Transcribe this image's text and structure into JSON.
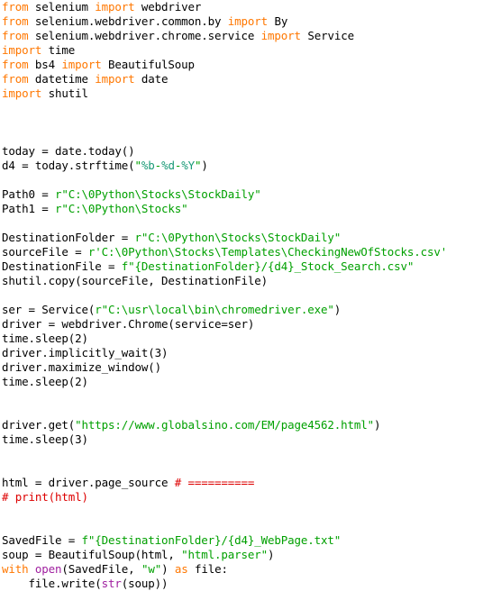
{
  "editor": {
    "name": "python-code-view",
    "language": "Python",
    "background_color": "#ffffff",
    "colors": {
      "keyword": "#ff7700",
      "string": "#00a000",
      "format_spec": "#1a9a77",
      "comment": "#dd0000",
      "builtin": "#a020a0",
      "plain": "#000000"
    }
  },
  "lines": [
    {
      "n": 1,
      "tokens": [
        {
          "t": "from",
          "c": "kw"
        },
        {
          "t": " selenium ",
          "c": "plain"
        },
        {
          "t": "import",
          "c": "kw"
        },
        {
          "t": " webdriver",
          "c": "plain"
        }
      ]
    },
    {
      "n": 2,
      "tokens": [
        {
          "t": "from",
          "c": "kw"
        },
        {
          "t": " selenium.webdriver.common.by ",
          "c": "plain"
        },
        {
          "t": "import",
          "c": "kw"
        },
        {
          "t": " By",
          "c": "plain"
        }
      ]
    },
    {
      "n": 3,
      "tokens": [
        {
          "t": "from",
          "c": "kw"
        },
        {
          "t": " selenium.webdriver.chrome.service ",
          "c": "plain"
        },
        {
          "t": "import",
          "c": "kw"
        },
        {
          "t": " Service",
          "c": "plain"
        }
      ]
    },
    {
      "n": 4,
      "tokens": [
        {
          "t": "import",
          "c": "kw"
        },
        {
          "t": " time",
          "c": "plain"
        }
      ]
    },
    {
      "n": 5,
      "tokens": [
        {
          "t": "from",
          "c": "kw"
        },
        {
          "t": " bs4 ",
          "c": "plain"
        },
        {
          "t": "import",
          "c": "kw"
        },
        {
          "t": " BeautifulSoup",
          "c": "plain"
        }
      ]
    },
    {
      "n": 6,
      "tokens": [
        {
          "t": "from",
          "c": "kw"
        },
        {
          "t": " datetime ",
          "c": "plain"
        },
        {
          "t": "import",
          "c": "kw"
        },
        {
          "t": " date",
          "c": "plain"
        }
      ]
    },
    {
      "n": 7,
      "tokens": [
        {
          "t": "import",
          "c": "kw"
        },
        {
          "t": " shutil",
          "c": "plain"
        }
      ]
    },
    {
      "n": 8,
      "tokens": []
    },
    {
      "n": 9,
      "tokens": []
    },
    {
      "n": 10,
      "tokens": []
    },
    {
      "n": 11,
      "tokens": [
        {
          "t": "today = date.today()",
          "c": "plain"
        }
      ]
    },
    {
      "n": 12,
      "tokens": [
        {
          "t": "d4 = today.strftime(",
          "c": "plain"
        },
        {
          "t": "\"",
          "c": "str"
        },
        {
          "t": "%b",
          "c": "fmt"
        },
        {
          "t": "-",
          "c": "str"
        },
        {
          "t": "%d",
          "c": "fmt"
        },
        {
          "t": "-",
          "c": "str"
        },
        {
          "t": "%Y",
          "c": "fmt"
        },
        {
          "t": "\"",
          "c": "str"
        },
        {
          "t": ")",
          "c": "plain"
        }
      ]
    },
    {
      "n": 13,
      "tokens": []
    },
    {
      "n": 14,
      "tokens": [
        {
          "t": "Path0 = ",
          "c": "plain"
        },
        {
          "t": "r\"C:\\0Python\\Stocks\\StockDaily\"",
          "c": "str"
        }
      ]
    },
    {
      "n": 15,
      "tokens": [
        {
          "t": "Path1 = ",
          "c": "plain"
        },
        {
          "t": "r\"C:\\0Python\\Stocks\"",
          "c": "str"
        }
      ]
    },
    {
      "n": 16,
      "tokens": []
    },
    {
      "n": 17,
      "tokens": [
        {
          "t": "DestinationFolder = ",
          "c": "plain"
        },
        {
          "t": "r\"C:\\0Python\\Stocks\\StockDaily\"",
          "c": "str"
        }
      ]
    },
    {
      "n": 18,
      "tokens": [
        {
          "t": "sourceFile = ",
          "c": "plain"
        },
        {
          "t": "r'C:\\0Python\\Stocks\\Templates\\CheckingNewOfStocks.csv'",
          "c": "str"
        }
      ]
    },
    {
      "n": 19,
      "tokens": [
        {
          "t": "DestinationFile = ",
          "c": "plain"
        },
        {
          "t": "f\"{DestinationFolder}/{d4}_Stock_Search.csv\"",
          "c": "str"
        }
      ]
    },
    {
      "n": 20,
      "tokens": [
        {
          "t": "shutil.copy(sourceFile, DestinationFile)",
          "c": "plain"
        }
      ]
    },
    {
      "n": 21,
      "tokens": []
    },
    {
      "n": 22,
      "tokens": [
        {
          "t": "ser = Service(",
          "c": "plain"
        },
        {
          "t": "r\"C:\\usr\\local\\bin\\chromedriver.exe\"",
          "c": "str"
        },
        {
          "t": ")",
          "c": "plain"
        }
      ]
    },
    {
      "n": 23,
      "tokens": [
        {
          "t": "driver = webdriver.Chrome(service=ser)",
          "c": "plain"
        }
      ]
    },
    {
      "n": 24,
      "tokens": [
        {
          "t": "time.sleep(2)",
          "c": "plain"
        }
      ]
    },
    {
      "n": 25,
      "tokens": [
        {
          "t": "driver.implicitly_wait(3)",
          "c": "plain"
        }
      ]
    },
    {
      "n": 26,
      "tokens": [
        {
          "t": "driver.maximize_window()",
          "c": "plain"
        }
      ]
    },
    {
      "n": 27,
      "tokens": [
        {
          "t": "time.sleep(2)",
          "c": "plain"
        }
      ]
    },
    {
      "n": 28,
      "tokens": []
    },
    {
      "n": 29,
      "tokens": []
    },
    {
      "n": 30,
      "tokens": [
        {
          "t": "driver.get(",
          "c": "plain"
        },
        {
          "t": "\"https://www.globalsino.com/EM/page4562.html\"",
          "c": "str"
        },
        {
          "t": ")",
          "c": "plain"
        }
      ]
    },
    {
      "n": 31,
      "tokens": [
        {
          "t": "time.sleep(3)",
          "c": "plain"
        }
      ]
    },
    {
      "n": 32,
      "tokens": []
    },
    {
      "n": 33,
      "tokens": []
    },
    {
      "n": 34,
      "tokens": [
        {
          "t": "html = driver.page_source ",
          "c": "plain"
        },
        {
          "t": "# ==========",
          "c": "com"
        }
      ]
    },
    {
      "n": 35,
      "tokens": [
        {
          "t": "# print(html)",
          "c": "com"
        }
      ]
    },
    {
      "n": 36,
      "tokens": []
    },
    {
      "n": 37,
      "tokens": []
    },
    {
      "n": 38,
      "tokens": [
        {
          "t": "SavedFile = ",
          "c": "plain"
        },
        {
          "t": "f\"{DestinationFolder}/{d4}_WebPage.txt\"",
          "c": "str"
        }
      ]
    },
    {
      "n": 39,
      "tokens": [
        {
          "t": "soup = BeautifulSoup(html, ",
          "c": "plain"
        },
        {
          "t": "\"html.parser\"",
          "c": "str"
        },
        {
          "t": ")",
          "c": "plain"
        }
      ]
    },
    {
      "n": 40,
      "tokens": [
        {
          "t": "with",
          "c": "kw"
        },
        {
          "t": " ",
          "c": "plain"
        },
        {
          "t": "open",
          "c": "bi"
        },
        {
          "t": "(SavedFile, ",
          "c": "plain"
        },
        {
          "t": "\"w\"",
          "c": "str"
        },
        {
          "t": ") ",
          "c": "plain"
        },
        {
          "t": "as",
          "c": "kw"
        },
        {
          "t": " file:",
          "c": "plain"
        }
      ]
    },
    {
      "n": 41,
      "tokens": [
        {
          "t": "    file.write(",
          "c": "plain"
        },
        {
          "t": "str",
          "c": "bi"
        },
        {
          "t": "(soup))",
          "c": "plain"
        }
      ]
    }
  ]
}
